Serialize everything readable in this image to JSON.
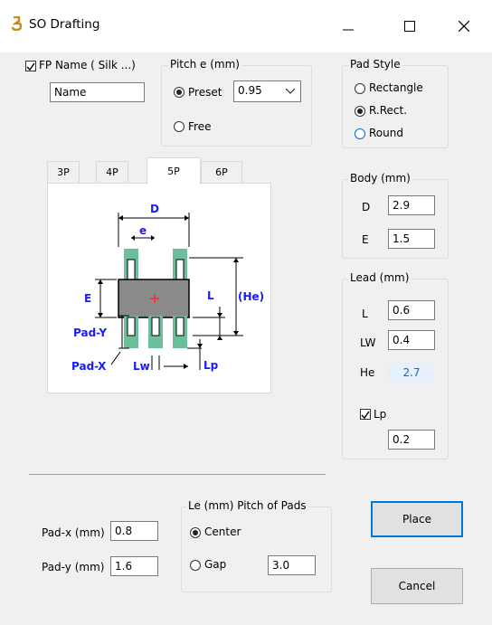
{
  "window": {
    "title": "SO Drafting"
  },
  "fp_name": {
    "label": "FP Name ( Silk ...)",
    "checked": true,
    "value": "Name"
  },
  "pitch": {
    "title": "Pitch  e (mm)",
    "preset_label": "Preset",
    "preset_value": "0.95",
    "free_label": "Free"
  },
  "pad_style": {
    "title": "Pad Style",
    "options": [
      "Rectangle",
      "R.Rect.",
      "Round"
    ],
    "selected": "R.Rect."
  },
  "tabs": [
    "3P",
    "4P",
    "5P",
    "6P"
  ],
  "active_tab": "5P",
  "diagram": {
    "labels": {
      "D": "D",
      "e": "e",
      "E": "E",
      "L": "L",
      "He": "(He)",
      "PadY": "Pad-Y",
      "PadX": "Pad-X",
      "Lw": "Lw",
      "Lp": "Lp"
    },
    "colors": {
      "pad": "#6cbf9a",
      "body": "#8a8a8a",
      "label": "#1a1aff",
      "center": "#ff2a2a"
    }
  },
  "body": {
    "title": "Body (mm)",
    "D_label": "D",
    "D": "2.9",
    "E_label": "E",
    "E": "1.5"
  },
  "lead": {
    "title": "Lead (mm)",
    "L_label": "L",
    "L": "0.6",
    "LW_label": "LW",
    "LW": "0.4",
    "He_label": "He",
    "He": "2.7",
    "Lp_label": "Lp",
    "Lp_checked": true,
    "Lp": "0.2"
  },
  "pad": {
    "x_label": "Pad-x (mm)",
    "x": "0.8",
    "y_label": "Pad-y (mm)",
    "y": "1.6"
  },
  "le": {
    "title": "Le (mm)  Pitch of Pads",
    "center_label": "Center",
    "gap_label": "Gap",
    "gap_value": "3.0",
    "selected": "Center"
  },
  "buttons": {
    "place": "Place",
    "cancel": "Cancel"
  }
}
